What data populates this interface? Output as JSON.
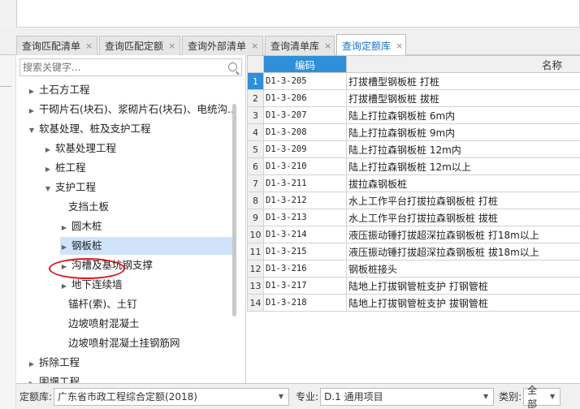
{
  "tabs": [
    {
      "label": "查询匹配清单",
      "active": false
    },
    {
      "label": "查询匹配定额",
      "active": false
    },
    {
      "label": "查询外部清单",
      "active": false
    },
    {
      "label": "查询清单库",
      "active": false
    },
    {
      "label": "查询定额库",
      "active": true
    }
  ],
  "tab_close_glyph": "×",
  "search": {
    "placeholder": "搜索关键字..."
  },
  "tree": [
    {
      "label": "土石方工程",
      "level": 0,
      "arrow": "right"
    },
    {
      "label": "干砌片石(块石)、浆砌片石(块石)、电统沟...",
      "level": 0,
      "arrow": "right"
    },
    {
      "label": "软基处理、桩及支护工程",
      "level": 0,
      "arrow": "down"
    },
    {
      "label": "软基处理工程",
      "level": 1,
      "arrow": "right"
    },
    {
      "label": "桩工程",
      "level": 1,
      "arrow": "right"
    },
    {
      "label": "支护工程",
      "level": 1,
      "arrow": "down"
    },
    {
      "label": "支挡土板",
      "level": 2,
      "arrow": "none"
    },
    {
      "label": "圆木桩",
      "level": 2,
      "arrow": "right"
    },
    {
      "label": "钢板桩",
      "level": 2,
      "arrow": "right",
      "selected": true
    },
    {
      "label": "沟槽及基坑钢支撑",
      "level": 2,
      "arrow": "right"
    },
    {
      "label": "地下连续墙",
      "level": 2,
      "arrow": "right"
    },
    {
      "label": "锚杆(索)、土钉",
      "level": 2,
      "arrow": "none"
    },
    {
      "label": "边坡喷射混凝土",
      "level": 2,
      "arrow": "none"
    },
    {
      "label": "边坡喷射混凝土挂钢筋网",
      "level": 2,
      "arrow": "none"
    },
    {
      "label": "拆除工程",
      "level": 0,
      "arrow": "right"
    },
    {
      "label": "围堰工程",
      "level": 0,
      "arrow": "right"
    }
  ],
  "grid": {
    "headers": {
      "code": "编码",
      "name": "名称"
    },
    "rows": [
      {
        "n": "1",
        "code": "D1-3-205",
        "name": "打拔槽型钢板桩 打桩"
      },
      {
        "n": "2",
        "code": "D1-3-206",
        "name": "打拔槽型钢板桩 拔桩"
      },
      {
        "n": "3",
        "code": "D1-3-207",
        "name": "陆上打拉森钢板桩 6m内"
      },
      {
        "n": "4",
        "code": "D1-3-208",
        "name": "陆上打拉森钢板桩 9m内"
      },
      {
        "n": "5",
        "code": "D1-3-209",
        "name": "陆上打拉森钢板桩 12m内"
      },
      {
        "n": "6",
        "code": "D1-3-210",
        "name": "陆上打拉森钢板桩 12m以上"
      },
      {
        "n": "7",
        "code": "D1-3-211",
        "name": "拔拉森钢板桩"
      },
      {
        "n": "8",
        "code": "D1-3-212",
        "name": "水上工作平台打拔拉森钢板桩 打桩"
      },
      {
        "n": "9",
        "code": "D1-3-213",
        "name": "水上工作平台打拔拉森钢板桩 拔桩"
      },
      {
        "n": "10",
        "code": "D1-3-214",
        "name": "液压振动锤打拔超深拉森钢板桩 打18m以上"
      },
      {
        "n": "11",
        "code": "D1-3-215",
        "name": "液压振动锤打拔超深拉森钢板桩 拔18m以上"
      },
      {
        "n": "12",
        "code": "D1-3-216",
        "name": "钢板桩接头"
      },
      {
        "n": "13",
        "code": "D1-3-217",
        "name": "陆地上打拔钢管桩支护 打钢管桩"
      },
      {
        "n": "14",
        "code": "D1-3-218",
        "name": "陆地上打拔钢管桩支护 拔钢管桩"
      }
    ]
  },
  "bottom": {
    "quota_label": "定额库:",
    "quota_value": "广东省市政工程综合定额(2018)",
    "major_label": "专业:",
    "major_value": "D.1 通用项目",
    "category_label": "类别:",
    "category_value": "全部"
  },
  "colors": {
    "accent": "#2f8fd8",
    "selected_row": "#cfe3fb",
    "highlight_ellipse": "#e0161b"
  }
}
